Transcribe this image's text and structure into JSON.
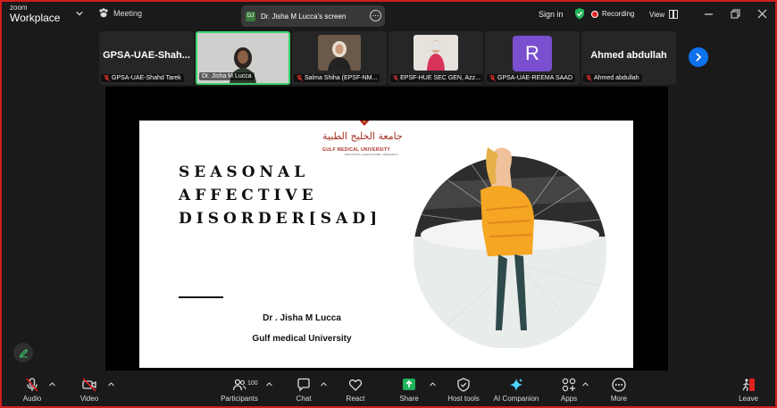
{
  "app": {
    "brand_small": "zoom",
    "brand_big": "Workplace"
  },
  "topbar": {
    "meeting_label": "Meeting",
    "share_initials": "DJ",
    "share_label": "Dr. Jisha M Lucca's screen",
    "signin_label": "Sign in",
    "recording_label": "Recording",
    "view_label": "View"
  },
  "participants": [
    {
      "big_name": "GPSA-UAE-Shah...",
      "label": "GPSA-UAE-Shahd Tarek"
    },
    {
      "big_name": "",
      "label": "Dr. Jisha M Lucca"
    },
    {
      "big_name": "",
      "label": "Salma Shiha (EPSF-NM..."
    },
    {
      "big_name": "",
      "label": "EPSF-HUE SEC GEN, Azz..."
    },
    {
      "big_name": "R",
      "label": "GPSA-UAE-REEMA SAAD"
    },
    {
      "big_name": "Ahmed abdullah",
      "label": "Ahmed abdullah"
    }
  ],
  "slide": {
    "university_ar": "جامعة الخليج الطبية",
    "university_en": "GULF MEDICAL UNIVERSITY",
    "university_sub": "EDUCATION • HEALTHCARE • RESEARCH",
    "title_line1": "SEASONAL",
    "title_line2": "AFFECTIVE",
    "title_line3": "DISORDER[SAD]",
    "author": "Dr . Jisha M Lucca",
    "affiliation": "Gulf medical University"
  },
  "toolbar": {
    "audio": "Audio",
    "video": "Video",
    "participants": "Participants",
    "participants_count": "100",
    "chat": "Chat",
    "react": "React",
    "share": "Share",
    "host_tools": "Host tools",
    "ai_companion": "AI Companion",
    "apps": "Apps",
    "more": "More",
    "leave": "Leave"
  },
  "colors": {
    "accent_green": "#3cd26e",
    "zoom_blue": "#0e72ed",
    "record_red": "#e02020",
    "share_green": "#1fb15a",
    "leave_red": "#e02020"
  }
}
